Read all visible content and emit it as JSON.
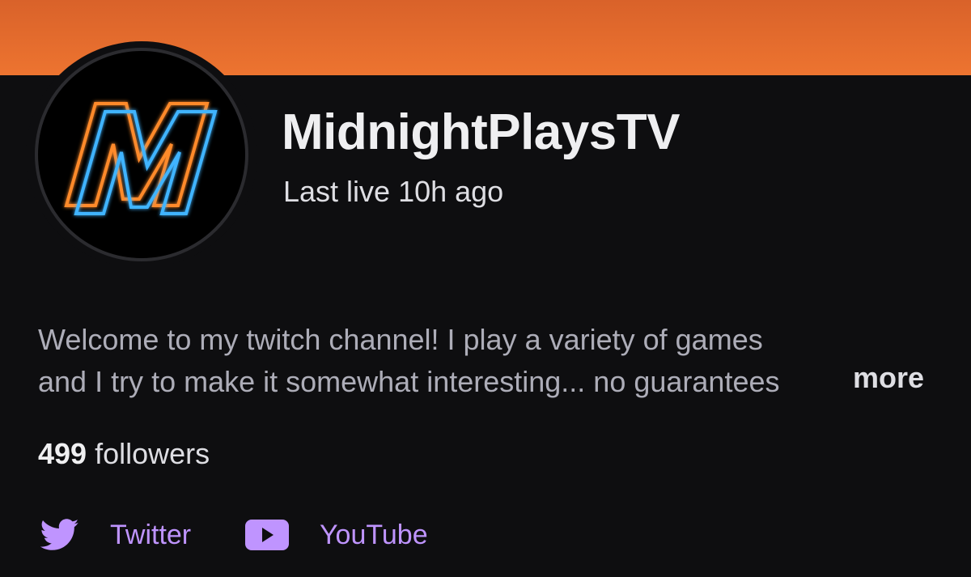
{
  "channel": {
    "name": "MidnightPlaysTV",
    "last_live": "Last live 10h ago",
    "avatar_letter": "M"
  },
  "bio": {
    "line1": "Welcome to my twitch channel! I play a variety of games",
    "line2": "and I try to make it somewhat interesting... no guarantees",
    "more_label": "more"
  },
  "followers": {
    "count": "499",
    "label": "followers"
  },
  "social_links": [
    {
      "label": "Twitter",
      "icon": "twitter-bird-icon"
    },
    {
      "label": "YouTube",
      "icon": "youtube-play-icon"
    }
  ],
  "colors": {
    "banner": "#ed7430",
    "background": "#0e0e10",
    "link": "#bf94ff",
    "logo_orange": "#ff8a2a",
    "logo_blue": "#3fb4ff"
  }
}
